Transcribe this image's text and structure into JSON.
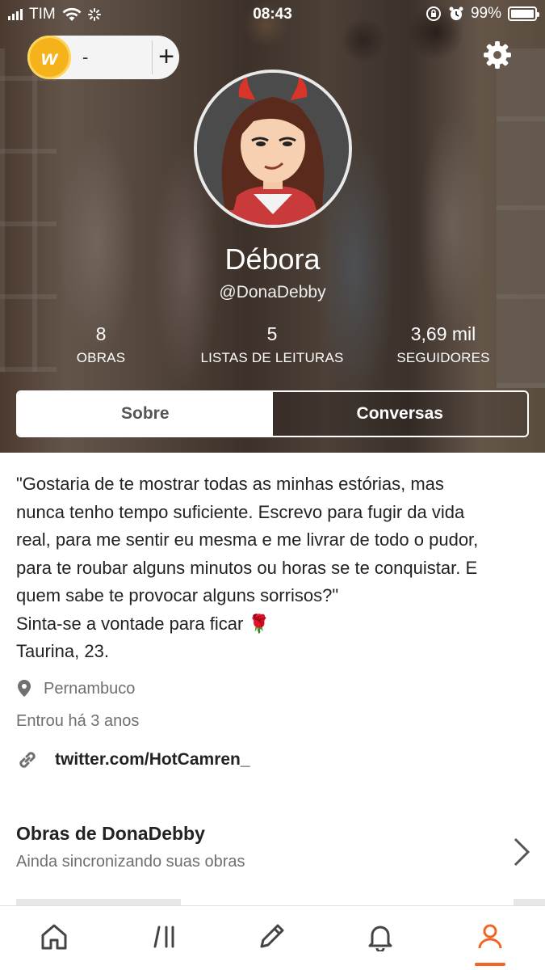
{
  "status_bar": {
    "carrier": "TIM",
    "time": "08:43",
    "battery": "99%",
    "battery_level": 0.99
  },
  "header": {
    "coins": {
      "count": "-",
      "add_symbol": "+"
    },
    "settings_icon": "gear-icon"
  },
  "profile": {
    "name": "Débora",
    "username": "@DonaDebby",
    "stats": [
      {
        "value": "8",
        "label": "OBRAS"
      },
      {
        "value": "5",
        "label": "LISTAS DE LEITURAS"
      },
      {
        "value": "3,69 mil",
        "label": "SEGUIDORES"
      }
    ]
  },
  "tabs": [
    {
      "label": "Sobre",
      "active": true
    },
    {
      "label": "Conversas",
      "active": false
    }
  ],
  "about": {
    "bio_lines": [
      "\"Gostaria de te mostrar todas as minhas estórias, mas",
      "nunca tenho tempo suficiente. Escrevo para fugir da vida",
      "real, para me sentir eu mesma e me livrar de todo o pudor,",
      "para te roubar alguns minutos ou horas se te conquistar. E",
      "quem sabe te provocar alguns sorrisos?\"",
      "Sinta-se a vontade para ficar 🌹",
      "Taurina, 23."
    ],
    "location": "Pernambuco",
    "joined": "Entrou há 3 anos",
    "link": "twitter.com/HotCamren_"
  },
  "works": {
    "title": "Obras de DonaDebby",
    "subtitle": "Ainda sincronizando suas obras"
  },
  "bottom_nav": [
    {
      "name": "home",
      "icon": "home-icon"
    },
    {
      "name": "library",
      "icon": "library-icon"
    },
    {
      "name": "write",
      "icon": "pencil-icon"
    },
    {
      "name": "notifications",
      "icon": "bell-icon"
    },
    {
      "name": "profile",
      "icon": "person-icon",
      "active": true
    }
  ],
  "colors": {
    "accent": "#f26522",
    "coin": "#f6b21b",
    "text": "#222222",
    "muted": "#6f6f6f"
  }
}
